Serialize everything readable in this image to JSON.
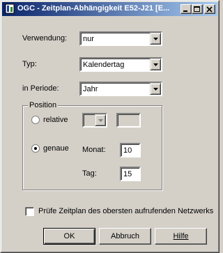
{
  "window": {
    "title": "OGC - Zeitplan-Abhängigkeit E52-J21 [E..."
  },
  "form": {
    "verwendung_label": "Verwendung:",
    "verwendung_value": "nur",
    "typ_label": "Typ:",
    "typ_value": "Kalendertag",
    "periode_label": "in Periode:",
    "periode_value": "Jahr"
  },
  "position": {
    "group_label": "Position",
    "relative_label": "relative",
    "genaue_label": "genaue",
    "monat_label": "Monat:",
    "monat_value": "10",
    "tag_label": "Tag:",
    "tag_value": "15",
    "selected": "genaue"
  },
  "checkbox": {
    "label": "Prüfe Zeitplan des obersten aufrufenden Netzwerks",
    "checked": false
  },
  "buttons": {
    "ok": "OK",
    "abbruch": "Abbruch",
    "hilfe": "Hilfe"
  },
  "colors": {
    "titlebar_start": "#0a246a",
    "titlebar_end": "#a6caf0",
    "face": "#d4d0c8"
  }
}
